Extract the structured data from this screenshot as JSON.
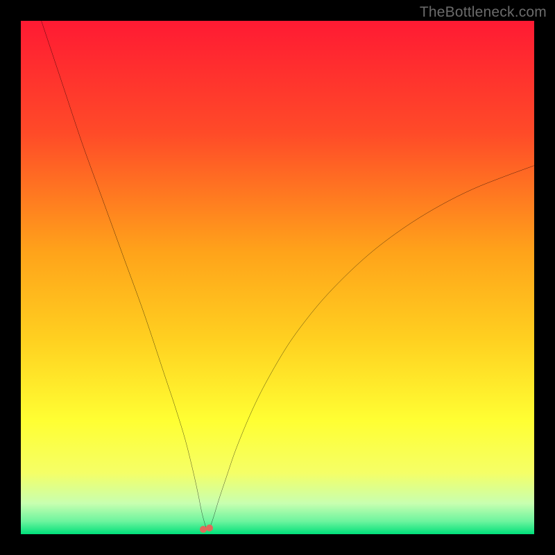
{
  "watermark": {
    "text": "TheBottleneck.com"
  },
  "chart_data": {
    "type": "line",
    "title": "",
    "xlabel": "",
    "ylabel": "",
    "xlim": [
      0,
      100
    ],
    "ylim": [
      0,
      100
    ],
    "grid": false,
    "legend": false,
    "background_gradient_stops": [
      {
        "offset": 0.0,
        "color": "#ff1a33"
      },
      {
        "offset": 0.22,
        "color": "#ff4b28"
      },
      {
        "offset": 0.45,
        "color": "#ffa31a"
      },
      {
        "offset": 0.62,
        "color": "#ffd020"
      },
      {
        "offset": 0.78,
        "color": "#ffff33"
      },
      {
        "offset": 0.88,
        "color": "#f5ff66"
      },
      {
        "offset": 0.94,
        "color": "#c8ffb0"
      },
      {
        "offset": 0.975,
        "color": "#6cf49e"
      },
      {
        "offset": 1.0,
        "color": "#00e07a"
      }
    ],
    "series": [
      {
        "name": "bottleneck-curve",
        "color": "#000000",
        "x": [
          4,
          8,
          12,
          16,
          20,
          24,
          28,
          30,
          32,
          33.5,
          34.5,
          35.2,
          35.8,
          36.3,
          36.8,
          37.5,
          38.5,
          40,
          42,
          45,
          48,
          52,
          56,
          60,
          65,
          70,
          76,
          82,
          88,
          94,
          100
        ],
        "y": [
          100,
          88,
          76,
          65,
          54,
          43,
          31,
          25,
          18.5,
          12.5,
          8,
          4.5,
          2.2,
          0.8,
          1.3,
          3.2,
          6.5,
          11,
          16.8,
          24,
          30,
          36.8,
          42.3,
          47,
          52,
          56.3,
          60.6,
          64.2,
          67.2,
          69.6,
          71.8
        ]
      }
    ],
    "markers": [
      {
        "name": "min-marker-1",
        "x": 35.6,
        "y": 1.0,
        "r": 5,
        "color": "#e06a5a"
      },
      {
        "name": "min-marker-2",
        "x": 36.8,
        "y": 1.2,
        "r": 5,
        "color": "#e06a5a"
      }
    ]
  }
}
